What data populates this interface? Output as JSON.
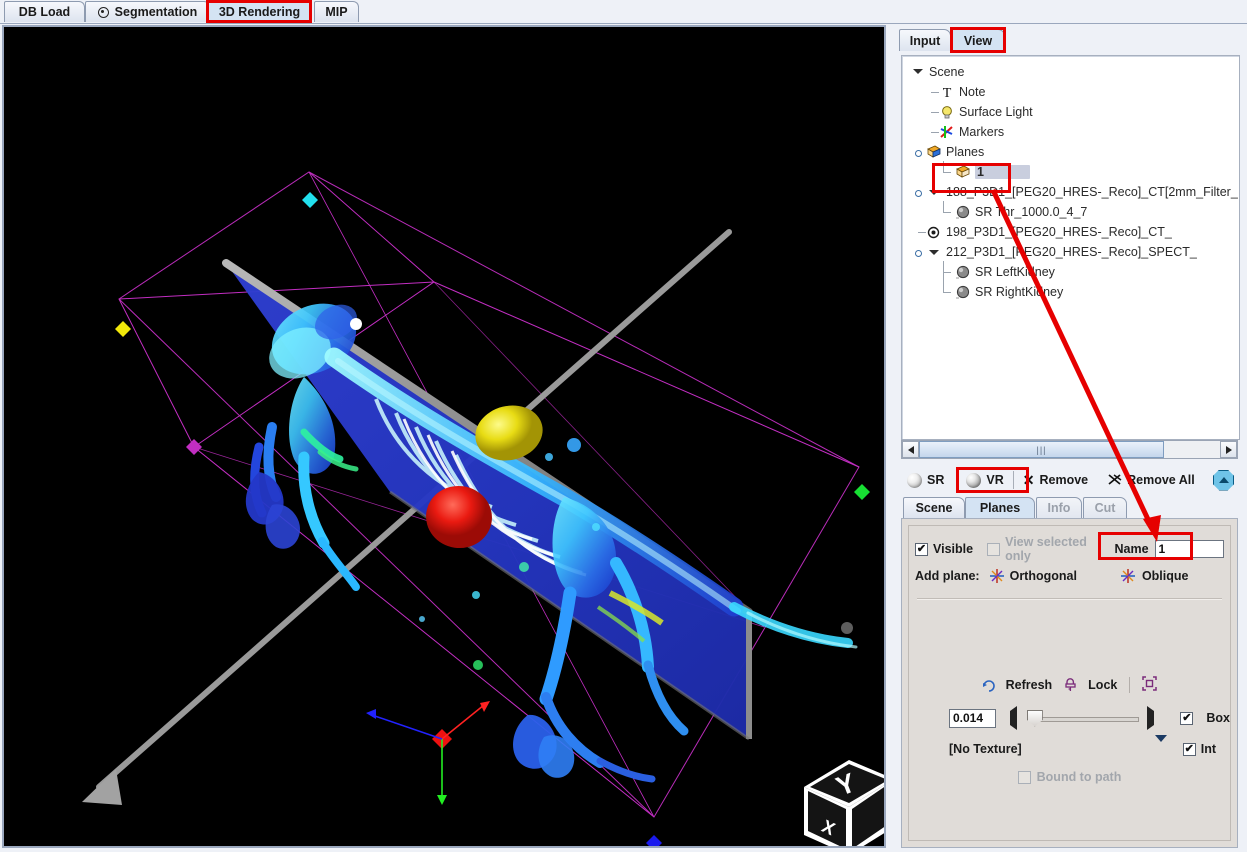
{
  "top_tabs": [
    {
      "label": "DB Load",
      "selected": false,
      "icon": null
    },
    {
      "label": "Segmentation",
      "selected": false,
      "icon": "target-dot-icon"
    },
    {
      "label": "3D Rendering",
      "selected": true,
      "icon": null,
      "highlighted": true
    },
    {
      "label": "MIP",
      "selected": false,
      "icon": null
    }
  ],
  "right_tabs": [
    {
      "label": "Input",
      "selected": false
    },
    {
      "label": "View",
      "selected": true,
      "highlighted": true
    }
  ],
  "tree": {
    "root_label": "Scene",
    "items": [
      {
        "label": "Note",
        "icon": "text-note-icon",
        "depth": 1
      },
      {
        "label": "Surface Light",
        "icon": "lightbulb-icon",
        "depth": 1
      },
      {
        "label": "Markers",
        "icon": "axes-markers-icon",
        "depth": 1
      },
      {
        "label": "Planes",
        "icon": "plane-cube-icon",
        "depth": 1,
        "expanded": true
      },
      {
        "label": "1",
        "icon": "plane-cube-icon",
        "depth": 2,
        "selected": true,
        "highlighted": true
      },
      {
        "label": "188_P3D1_[PEG20_HRES-_Reco]_CT[2mm_Filter_",
        "icon": "expand-triangle-icon",
        "depth": 1,
        "expanded": true
      },
      {
        "label": "SR Thr_1000.0_4_7",
        "icon": "surface-sphere-icon",
        "depth": 2
      },
      {
        "label": "198_P3D1_[PEG20_HRES-_Reco]_CT_",
        "icon": "radio-dot-icon",
        "depth": 1
      },
      {
        "label": "212_P3D1_[PEG20_HRES-_Reco]_SPECT_",
        "icon": "expand-triangle-icon",
        "depth": 1,
        "expanded": true
      },
      {
        "label": "SR LeftKidney",
        "icon": "surface-sphere-icon",
        "depth": 2
      },
      {
        "label": "SR RightKidney",
        "icon": "surface-sphere-icon",
        "depth": 2
      }
    ]
  },
  "scrollbar": {
    "thumb_grip": "|||"
  },
  "actions": [
    {
      "label": "SR",
      "icon": "sphere-sr-icon"
    },
    {
      "label": "VR",
      "icon": "sphere-vr-icon"
    },
    {
      "label": "Remove",
      "icon": "x-icon"
    },
    {
      "label": "Remove All",
      "icon": "double-x-icon"
    }
  ],
  "collapse_button": {
    "icon": "up-arrow-octagon-icon"
  },
  "lower_tabs": [
    {
      "label": "Scene",
      "selected": false,
      "enabled": true
    },
    {
      "label": "Planes",
      "selected": true,
      "enabled": true,
      "highlighted": true
    },
    {
      "label": "Info",
      "selected": false,
      "enabled": false
    },
    {
      "label": "Cut",
      "selected": false,
      "enabled": false
    }
  ],
  "planes_panel": {
    "visible_label": "Visible",
    "visible_checked": true,
    "view_selected_only_label": "View selected only",
    "view_selected_only_checked": false,
    "view_selected_only_enabled": false,
    "name_label": "Name",
    "name_value": "1",
    "add_plane_label": "Add plane:",
    "orthogonal_label": "Orthogonal",
    "oblique_label": "Oblique",
    "oblique_highlighted": true,
    "refresh_label": "Refresh",
    "lock_label": "Lock",
    "fit_icon": "fit-bounds-icon",
    "opacity_value": "0.014",
    "box_label": "Box",
    "box_checked": true,
    "texture_value": "[No Texture]",
    "int_label": "Int",
    "int_checked": true,
    "bound_to_path_label": "Bound to path",
    "bound_to_path_checked": false,
    "bound_to_path_enabled": false
  },
  "viewport": {
    "name": "3d-rendering-viewport",
    "background": "#000000",
    "orientation_cube_labels": [
      "Y",
      "X"
    ],
    "bounding_box_color": "#cc33cc",
    "plane_color": "#2b3fc4",
    "handle_colors": {
      "cyan": "#22e0ee",
      "yellow": "#f2e80a",
      "magenta": "#cc22cc",
      "green": "#17e033",
      "blue": "#1a1aee",
      "red": "#ee1111",
      "white": "#ffffff",
      "gray": "#6a6a6a"
    },
    "axis_arrow_colors": {
      "x": "#ff2222",
      "y": "#22ff22",
      "z": "#2222ff"
    },
    "pointer_arrow_color": "#9a9a9a"
  },
  "annotation": {
    "color": "#e60000",
    "arrow_from": "tree-item-plane-1",
    "arrow_to": "oblique-button"
  }
}
